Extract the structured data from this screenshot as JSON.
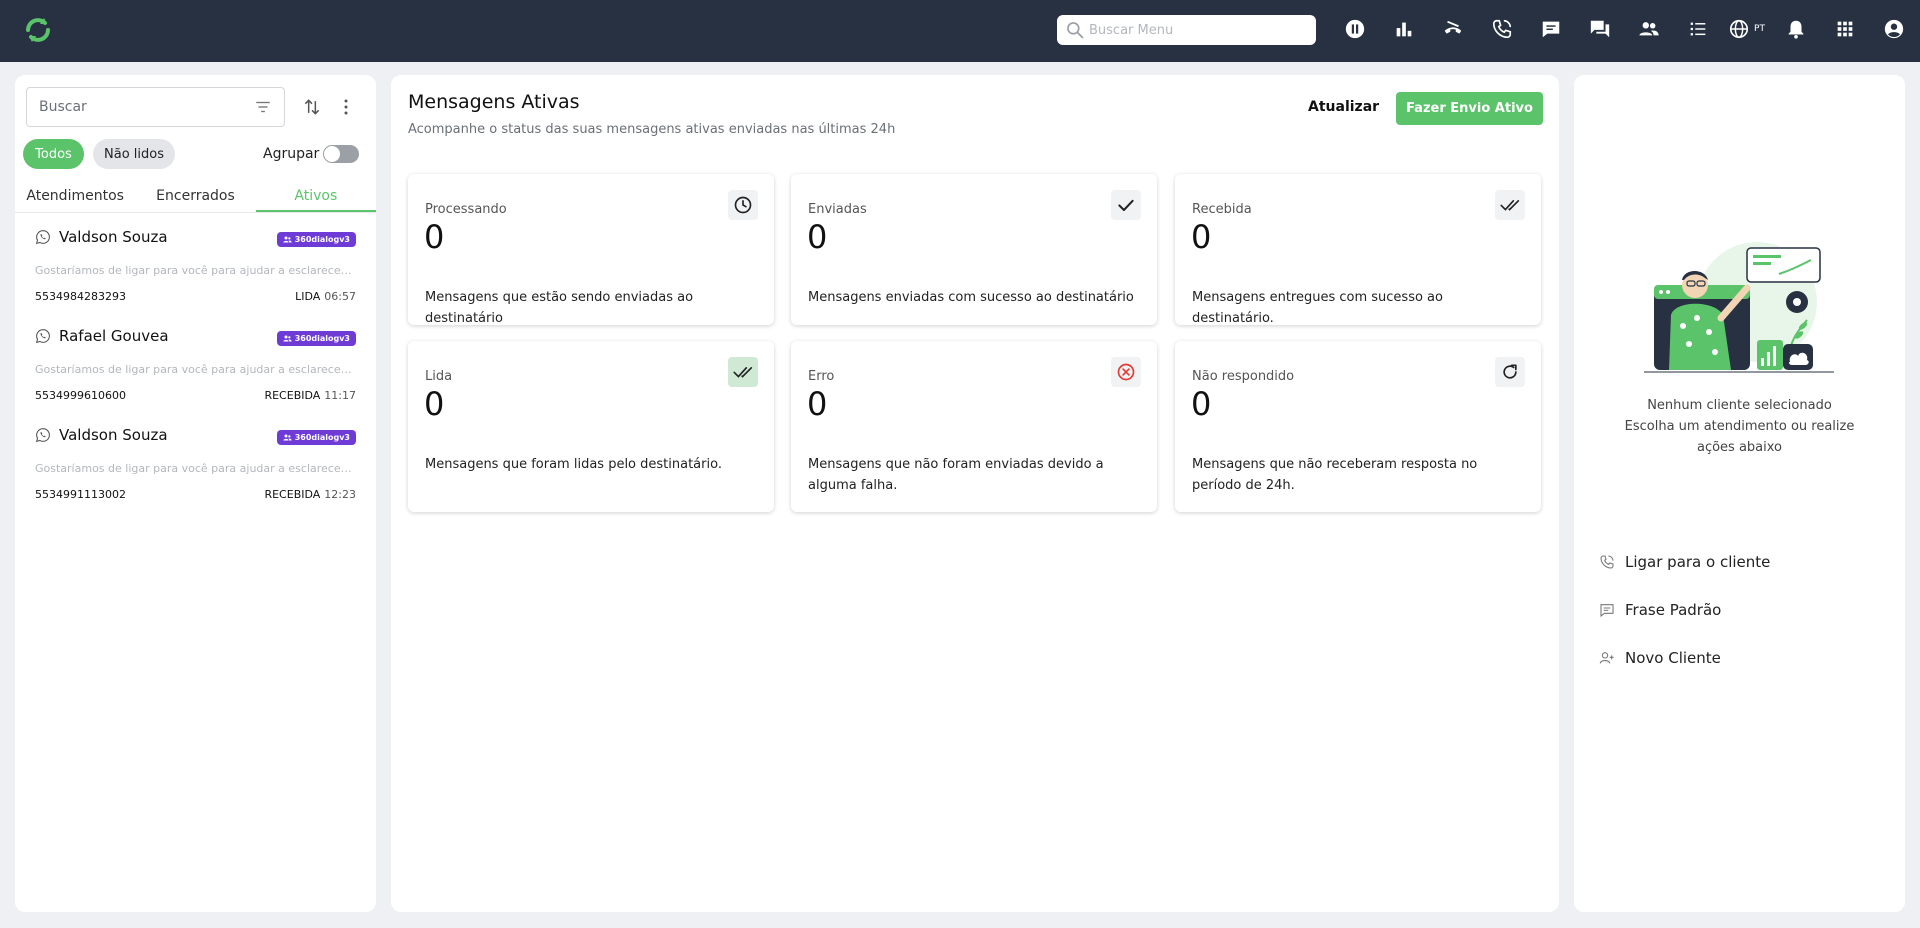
{
  "topbar": {
    "search_placeholder": "Buscar Menu",
    "language": "PT",
    "icons": [
      "pause-icon",
      "chart-icon",
      "call-end-icon",
      "phone-icon",
      "chat-icon",
      "chats-icon",
      "people-icon",
      "list-icon",
      "globe-icon",
      "bell-icon",
      "apps-icon",
      "account-icon"
    ]
  },
  "sidebar": {
    "search_placeholder": "Buscar",
    "filters": {
      "all": "Todos",
      "unread": "Não lidos"
    },
    "group_label": "Agrupar",
    "tabs": [
      "Atendimentos",
      "Encerrados",
      "Ativos"
    ],
    "conversations": [
      {
        "name": "Valdson Souza",
        "badge": "360dialogv3",
        "preview": "Gostaríamos de ligar para você para ajudar a esclarecer suas dúvidas",
        "phone": "5534984283293",
        "status": "LIDA",
        "time": "06:57"
      },
      {
        "name": "Rafael Gouvea",
        "badge": "360dialogv3",
        "preview": "Gostaríamos de ligar para você para ajudar a esclarecer suas dúvidas",
        "phone": "5534999610600",
        "status": "RECEBIDA",
        "time": "11:17"
      },
      {
        "name": "Valdson Souza",
        "badge": "360dialogv3",
        "preview": "Gostaríamos de ligar para você para ajudar a esclarecer suas dúvidas",
        "phone": "5534991113002",
        "status": "RECEBIDA",
        "time": "12:23"
      }
    ]
  },
  "main": {
    "title": "Mensagens Ativas",
    "subtitle": "Acompanhe o status das suas mensagens ativas enviadas nas últimas 24h",
    "refresh_label": "Atualizar",
    "send_label": "Fazer Envio Ativo",
    "cards": [
      {
        "label": "Processando",
        "value": "0",
        "desc": "Mensagens que estão sendo enviadas ao destinatário",
        "icon": "clock-icon"
      },
      {
        "label": "Enviadas",
        "value": "0",
        "desc": "Mensagens enviadas com sucesso ao destinatário",
        "icon": "check-icon"
      },
      {
        "label": "Recebida",
        "value": "0",
        "desc": "Mensagens entregues com sucesso ao destinatário.",
        "icon": "double-check-icon"
      },
      {
        "label": "Lida",
        "value": "0",
        "desc": "Mensagens que foram lidas pelo destinatário.",
        "icon": "double-check-green-icon"
      },
      {
        "label": "Erro",
        "value": "0",
        "desc": "Mensagens que não foram enviadas devido a alguma falha.",
        "icon": "error-icon"
      },
      {
        "label": "Não respondido",
        "value": "0",
        "desc": "Mensagens que não receberam resposta no período de 24h.",
        "icon": "refresh-icon"
      }
    ]
  },
  "right": {
    "no_client_line1": "Nenhum cliente selecionado",
    "no_client_line2": "Escolha um atendimento ou realize ações abaixo",
    "actions": [
      "Ligar para o cliente",
      "Frase Padrão",
      "Novo Cliente"
    ]
  },
  "colors": {
    "accent": "#5bc46a",
    "topbar": "#273142",
    "badge": "#6f3bd6",
    "error": "#e53935"
  }
}
